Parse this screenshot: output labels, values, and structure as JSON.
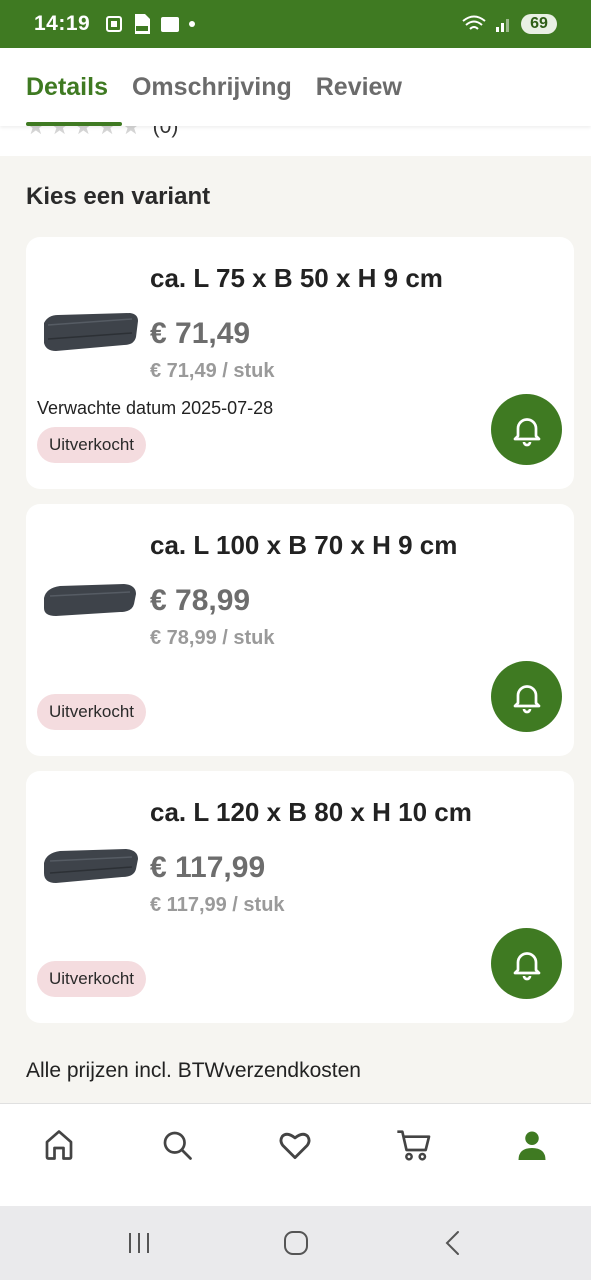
{
  "status_bar": {
    "time": "14:19",
    "battery": "69",
    "icons": [
      "screenshot-icon",
      "pdf-icon",
      "sim-icon",
      "dot-icon",
      "wifi-icon",
      "signal-icon"
    ]
  },
  "tabs": [
    {
      "label": "Details",
      "active": true
    },
    {
      "label": "Omschrijving",
      "active": false
    },
    {
      "label": "Review",
      "active": false
    }
  ],
  "rating": {
    "stars": 0,
    "max": 5,
    "count_text": "(0)"
  },
  "section_title": "Kies een variant",
  "variants": [
    {
      "name": "ca. L 75 x B 50 x H 9 cm",
      "price": "€ 71,49",
      "unit_price": "€ 71,49 / stuk",
      "expected": "Verwachte datum 2025-07-28",
      "status": "Uitverkocht"
    },
    {
      "name": "ca. L 100 x B 70 x H 9 cm",
      "price": "€ 78,99",
      "unit_price": "€ 78,99 / stuk",
      "expected": "",
      "status": "Uitverkocht"
    },
    {
      "name": "ca. L 120 x B 80 x H 10 cm",
      "price": "€ 117,99",
      "unit_price": "€ 117,99 / stuk",
      "expected": "",
      "status": "Uitverkocht"
    }
  ],
  "footnote": "Alle prijzen incl. BTWverzendkosten",
  "bottom_nav": [
    "home-icon",
    "search-icon",
    "heart-icon",
    "cart-icon",
    "profile-icon"
  ],
  "system_nav": [
    "recent-apps-icon",
    "home-circle-icon",
    "back-icon"
  ],
  "colors": {
    "brand_green": "#3f7a22",
    "badge_pink": "#f4dcdf",
    "background": "#f6f5f1"
  }
}
